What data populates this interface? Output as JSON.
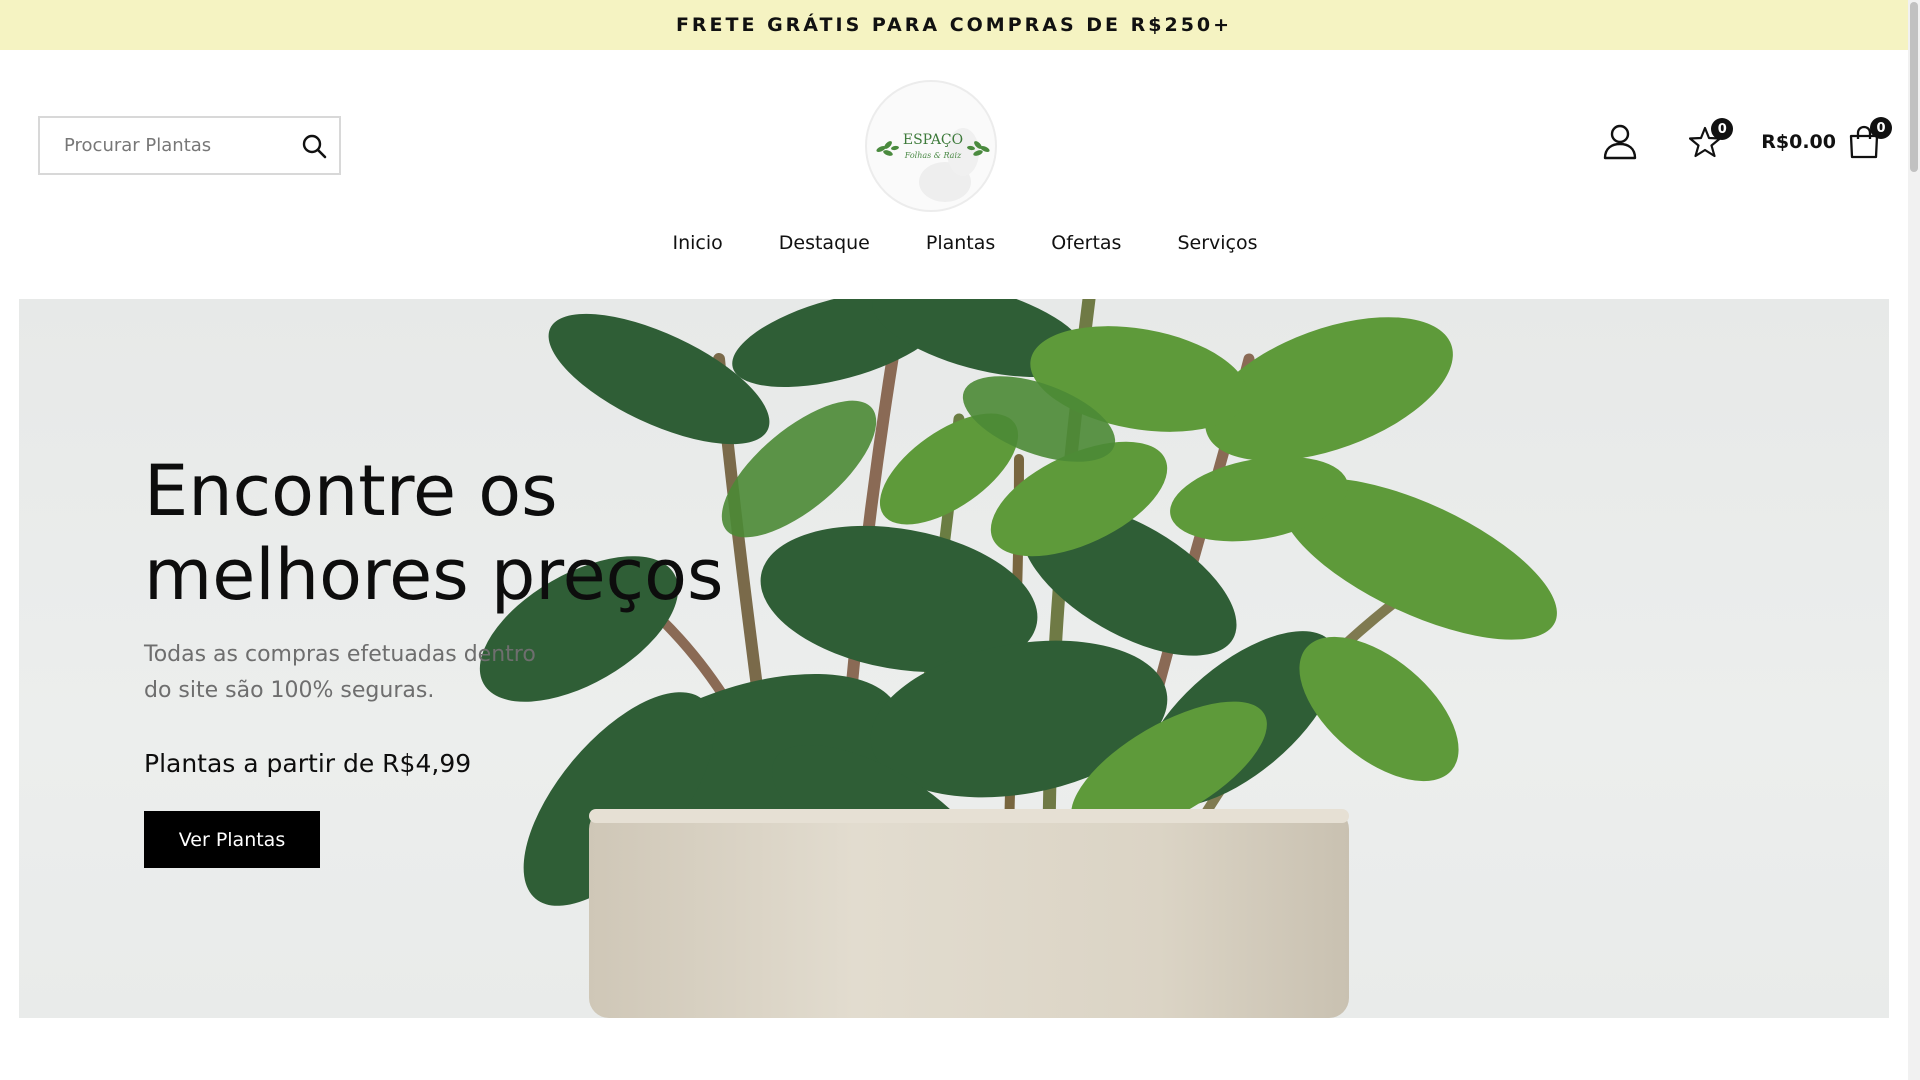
{
  "announcement": "FRETE GRÁTIS PARA COMPRAS DE R$250+",
  "search": {
    "placeholder": "Procurar Plantas",
    "icon": "search-icon"
  },
  "logo": {
    "text_top": "ESPAÇO",
    "text_bottom": "Folhas & Raiz"
  },
  "header_actions": {
    "account_icon": "user-icon",
    "wishlist_icon": "star-icon",
    "wishlist_count": "0",
    "cart_total": "R$0.00",
    "cart_icon": "shopping-bag-icon",
    "cart_count": "0"
  },
  "nav": {
    "items": [
      {
        "label": "Inicio"
      },
      {
        "label": "Destaque"
      },
      {
        "label": "Plantas"
      },
      {
        "label": "Ofertas"
      },
      {
        "label": "Serviços"
      }
    ]
  },
  "hero": {
    "title_line1": "Encontre os",
    "title_line2": "melhores preços",
    "subtitle": "Todas as compras efetuadas dentro do site são 100% seguras.",
    "price_text": "Plantas a partir de R$4,99",
    "button_label": "Ver Plantas"
  },
  "colors": {
    "announcement_bg": "#f5f3c2",
    "button_bg": "#000000",
    "hero_bg": "#e9ebea",
    "leaf_dark": "#2f5e36",
    "leaf_light": "#6aa43a",
    "pot": "#ddd6c8"
  }
}
